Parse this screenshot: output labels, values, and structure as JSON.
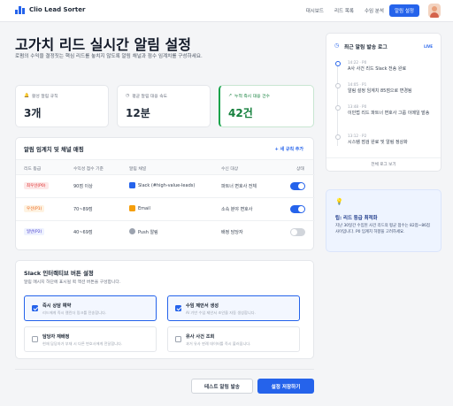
{
  "app": {
    "name": "Clio Lead Sorter"
  },
  "nav": [
    {
      "label": "대시보드",
      "active": false
    },
    {
      "label": "리드 목록",
      "active": false
    },
    {
      "label": "수임 분석",
      "active": false
    },
    {
      "label": "알림 설정",
      "active": true
    }
  ],
  "page": {
    "title": "고가치 리드 실시간 알림 설정",
    "description": "로펌의 수익을 결정짓는 핵심 리드를 놓치지 않도록 알림 채널과 점수 임계치를 구성하세요."
  },
  "stats": [
    {
      "label": "활성 알림 규칙",
      "value": "3개"
    },
    {
      "label": "평균 알림 대응 속도",
      "value": "12분"
    },
    {
      "label": "누적 즉시 대응 건수",
      "value": "42건"
    }
  ],
  "thresholds": {
    "title": "알림 임계치 및 채널 매핑",
    "add_rule": "+ 새 규칙 추가",
    "columns": [
      "리드 등급",
      "수익성 점수 기준",
      "알림 채널",
      "수신 대상",
      "상태"
    ],
    "rows": [
      {
        "grade": "최우선(P0)",
        "score": "90점 이상",
        "channel": "Slack (#high-value-leads)",
        "target": "파트너 변호사 전체",
        "enabled": true
      },
      {
        "grade": "우선(P1)",
        "score": "70~89점",
        "channel": "Email",
        "target": "소속 분야 변호사",
        "enabled": true
      },
      {
        "grade": "일반(P2)",
        "score": "40~69점",
        "channel": "Push 알림",
        "target": "배정 담당자",
        "enabled": false
      }
    ]
  },
  "slack": {
    "title": "Slack 인터랙티브 버튼 설정",
    "subtitle": "알림 메시지 하단에 표시될 퀵 액션 버튼을 구성합니다.",
    "options": [
      {
        "title": "즉시 상담 예약",
        "sub": "리드에게 즉시 캘린더 링크를 전송합니다.",
        "checked": true
      },
      {
        "title": "수임 제안서 생성",
        "sub": "AI 기반 수임 제안서 초안을 자동 생성합니다.",
        "checked": true
      },
      {
        "title": "담당자 재배정",
        "sub": "현재 담당자가 부재 시 다른 변호사에게 전달합니다.",
        "checked": false
      },
      {
        "title": "유사 사건 조회",
        "sub": "과거 유사 판례 데이터를 즉시 불러옵니다.",
        "checked": false
      }
    ]
  },
  "actions": {
    "test": "테스트 알림 발송",
    "save": "설정 저장하기"
  },
  "log": {
    "title": "최근 알림 발송 로그",
    "live": "LIVE",
    "items": [
      {
        "time": "14:22 · P0",
        "text": "A사 사건 리드 Slack 전송 완료"
      },
      {
        "time": "14:05 · P1",
        "text": "알림 설정 임계치 85점으로 변경됨"
      },
      {
        "time": "13:48 · P0",
        "text": "이민법 리드 파트너 변호사 그룹 이메일 발송"
      },
      {
        "time": "13:12 · P2",
        "text": "시스템 점검 완료 및 알림 정상화"
      }
    ],
    "view_all": "전체 로그 보기"
  },
  "tip": {
    "title": "팁: 리드 등급 최적화",
    "text": "지난 30일간 수임된 사건 리드의 평균 점수는 82점~86점 사이입니다. P0 임계치 하향을 고려하세요."
  },
  "colors": {
    "accent": "#2563eb",
    "success": "#16a34a"
  }
}
